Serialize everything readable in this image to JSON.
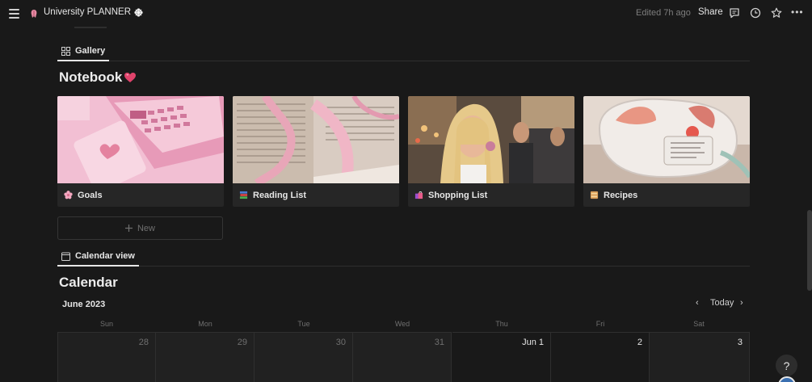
{
  "topbar": {
    "title": "University PLANNER",
    "edited": "Edited 7h ago",
    "share": "Share",
    "more": "•••"
  },
  "gallery": {
    "tab_label": "Gallery",
    "title": "Notebook",
    "cards": [
      {
        "label": "Goals",
        "icon": "cherry-blossom-icon"
      },
      {
        "label": "Reading List",
        "icon": "books-icon"
      },
      {
        "label": "Shopping List",
        "icon": "shopping-bags-icon"
      },
      {
        "label": "Recipes",
        "icon": "pancakes-icon"
      }
    ],
    "new_label": "New"
  },
  "calendar": {
    "tab_label": "Calendar view",
    "title": "Calendar",
    "month": "June 2023",
    "today": "Today",
    "weekdays": [
      "Sun",
      "Mon",
      "Tue",
      "Wed",
      "Thu",
      "Fri",
      "Sat"
    ],
    "days": [
      "28",
      "29",
      "30",
      "31",
      "Jun 1",
      "2",
      "3"
    ]
  },
  "help": "?",
  "colors": {
    "background": "#191919",
    "card": "#262626",
    "accent_heart": "#e0436b"
  }
}
